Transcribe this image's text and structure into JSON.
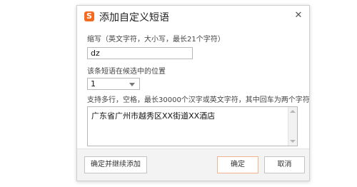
{
  "dialog": {
    "title": "添加自定义短语",
    "icon_glyph": "S",
    "close_glyph": "✕"
  },
  "abbr": {
    "label": "缩写（英文字符，大小写，最长21个字符）",
    "value": "dz"
  },
  "position": {
    "label": "该条短语在候选中的位置",
    "value": "1"
  },
  "phrase": {
    "label": "支持多行，空格，最长30000个汉字或英文字符，其中回车为两个字符",
    "value": "广东省广州市越秀区XX街道XX酒店"
  },
  "buttons": {
    "confirm_continue": "确定并继续添加",
    "confirm": "确定",
    "cancel": "取消"
  },
  "colors": {
    "accent": "#f46b1e",
    "primary_button_border": "#f1b48f"
  }
}
